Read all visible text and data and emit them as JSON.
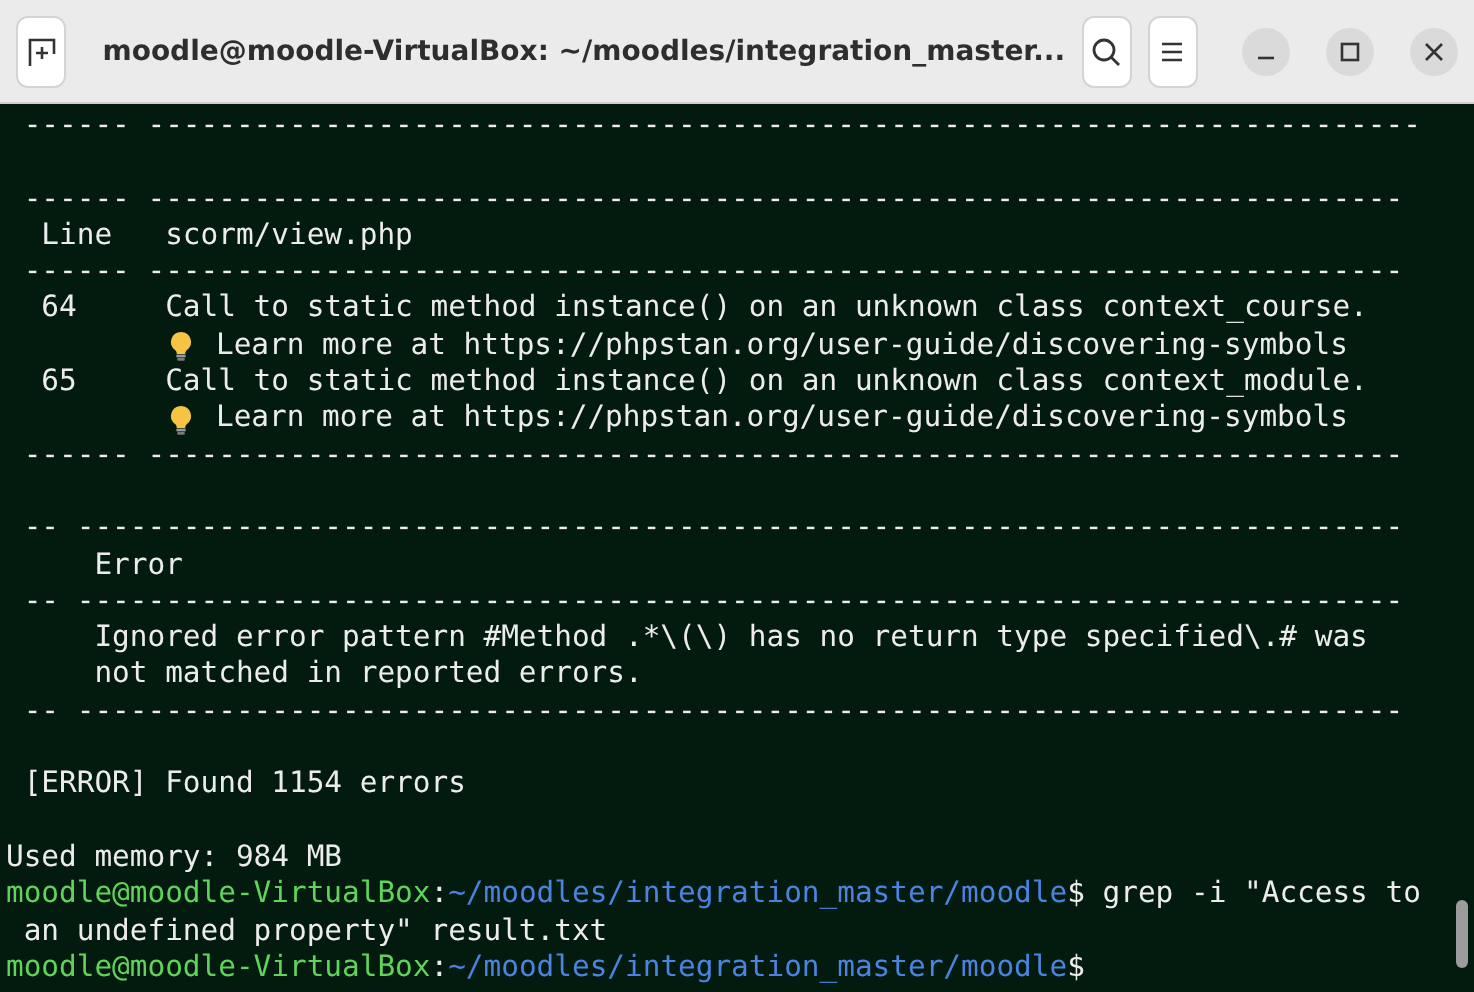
{
  "window": {
    "title": "moodle@moodle-VirtualBox: ~/moodles/integration_master..."
  },
  "terminal": {
    "lines": [
      {
        "kind": "output",
        "text": " ------ ------------------------------------------------------------------------"
      },
      {
        "kind": "blank"
      },
      {
        "kind": "output",
        "text": " ------ -----------------------------------------------------------------------"
      },
      {
        "kind": "output",
        "text": "  Line   scorm/view.php"
      },
      {
        "kind": "output",
        "text": " ------ -----------------------------------------------------------------------"
      },
      {
        "kind": "output",
        "text": "  64     Call to static method instance() on an unknown class context_course."
      },
      {
        "kind": "hint",
        "text": "Learn more at https://phpstan.org/user-guide/discovering-symbols"
      },
      {
        "kind": "output",
        "text": "  65     Call to static method instance() on an unknown class context_module."
      },
      {
        "kind": "hint",
        "text": "Learn more at https://phpstan.org/user-guide/discovering-symbols"
      },
      {
        "kind": "output",
        "text": " ------ -----------------------------------------------------------------------"
      },
      {
        "kind": "blank"
      },
      {
        "kind": "output",
        "text": " -- ---------------------------------------------------------------------------"
      },
      {
        "kind": "output",
        "text": "     Error"
      },
      {
        "kind": "output",
        "text": " -- ---------------------------------------------------------------------------"
      },
      {
        "kind": "output",
        "text": "     Ignored error pattern #Method .*\\(\\) has no return type specified\\.# was"
      },
      {
        "kind": "output",
        "text": "     not matched in reported errors."
      },
      {
        "kind": "output",
        "text": " -- ---------------------------------------------------------------------------"
      },
      {
        "kind": "blank"
      },
      {
        "kind": "output",
        "text": " [ERROR] Found 1154 errors"
      },
      {
        "kind": "blank"
      },
      {
        "kind": "output",
        "text": "Used memory: 984 MB"
      },
      {
        "kind": "prompt",
        "user": "moodle@moodle-VirtualBox",
        "separator": ":",
        "path": "~/moodles/integration_master/moodle",
        "symbol": "$",
        "command": "grep -i \"Access to"
      },
      {
        "kind": "output",
        "text": " an undefined property\" result.txt"
      },
      {
        "kind": "prompt",
        "user": "moodle@moodle-VirtualBox",
        "separator": ":",
        "path": "~/moodles/integration_master/moodle",
        "symbol": "$"
      }
    ]
  }
}
